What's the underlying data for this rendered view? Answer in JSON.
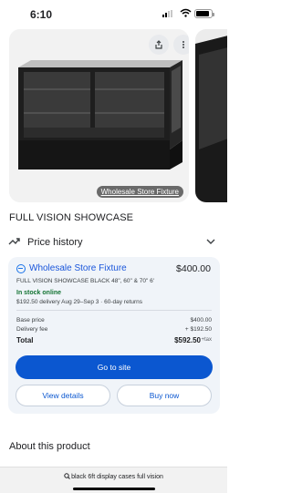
{
  "status_bar": {
    "time": "6:10"
  },
  "gallery": {
    "source_caption": "Wholesale Store Fixture"
  },
  "product": {
    "title": "FULL VISION SHOWCASE"
  },
  "price_history": {
    "label": "Price history"
  },
  "offer": {
    "seller": "Wholesale Store Fixture",
    "price": "$400.00",
    "description": "FULL VISION SHOWCASE BLACK 48\", 60\" & 70\" 6'",
    "stock": "In stock online",
    "delivery": "$192.50 delivery Aug 29–Sep 3 · 60-day returns",
    "base_price_label": "Base price",
    "base_price_value": "$400.00",
    "delivery_fee_label": "Delivery fee",
    "delivery_fee_value": "+ $192.50",
    "total_label": "Total",
    "total_value": "$592.50",
    "tax_label": "+tax",
    "go_button": "Go to site",
    "details_button": "View details",
    "buy_button": "Buy now"
  },
  "about": {
    "heading": "About this product"
  },
  "search_bar": {
    "query": "black 6ft display cases full vision"
  },
  "colors": {
    "accent": "#0b57d0",
    "link": "#1a56db",
    "in_stock": "#137333",
    "card_bg": "#f0f4f9"
  },
  "icons": [
    "share-icon",
    "more-vert-icon",
    "trending-icon",
    "chevron-down-icon",
    "store-icon",
    "search-icon",
    "wifi-icon",
    "battery-icon"
  ]
}
